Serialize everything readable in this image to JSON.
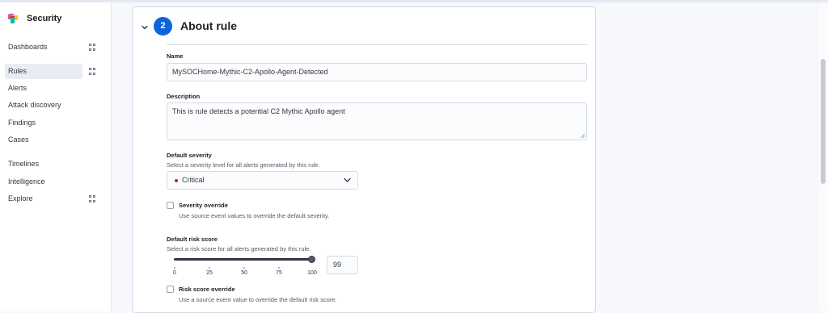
{
  "app": {
    "title": "Security"
  },
  "sidebar": {
    "items": [
      {
        "label": "Dashboards",
        "has_grid_icon": true
      },
      {
        "label": "Rules",
        "has_grid_icon": true,
        "active": true
      },
      {
        "label": "Alerts"
      },
      {
        "label": "Attack discovery"
      },
      {
        "label": "Findings"
      },
      {
        "label": "Cases"
      },
      {
        "label": "Timelines"
      },
      {
        "label": "Intelligence"
      },
      {
        "label": "Explore",
        "has_grid_icon": true
      }
    ]
  },
  "section": {
    "step_number": "2",
    "title": "About rule",
    "expanded": true
  },
  "form": {
    "name": {
      "label": "Name",
      "value": "MySOCHome-Mythic-C2-Apollo-Agent-Detected"
    },
    "description": {
      "label": "Description",
      "value": "This is rule detects a potential C2 Mythic Apollo agent"
    },
    "severity": {
      "label": "Default severity",
      "help": "Select a severity level for all alerts generated by this rule.",
      "value": "Critical",
      "color": "#bd271e"
    },
    "severity_override": {
      "label": "Severity override",
      "help": "Use source event values to override the default severity.",
      "checked": false
    },
    "risk_score": {
      "label": "Default risk score",
      "help": "Select a risk score for all alerts generated by this rule.",
      "value": "99",
      "ticks": [
        "0",
        "25",
        "50",
        "75",
        "100"
      ]
    },
    "risk_score_override": {
      "label": "Risk score override",
      "help": "Use a source event value to override the default risk score.",
      "checked": false
    }
  },
  "colors": {
    "accent": "#0b64dd",
    "critical": "#bd271e"
  }
}
